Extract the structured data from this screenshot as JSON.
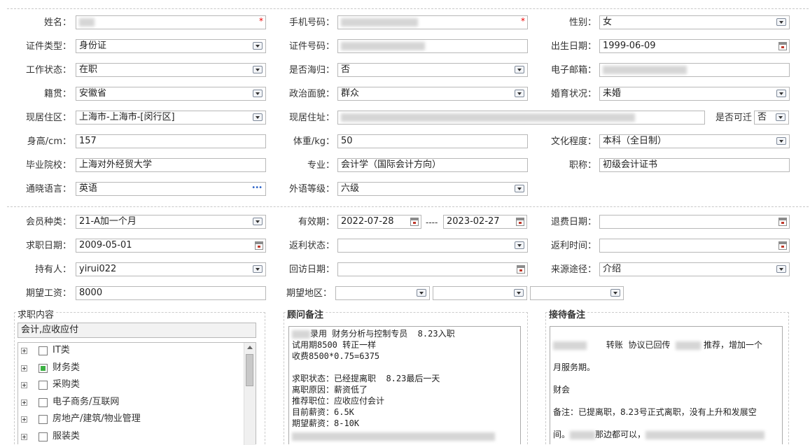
{
  "personal": {
    "name_label": "姓名：",
    "phone_label": "手机号码：",
    "gender_label": "性别：",
    "gender_value": "女",
    "id_type_label": "证件类型：",
    "id_type_value": "身份证",
    "id_number_label": "证件号码：",
    "birth_label": "出生日期：",
    "birth_value": "1999-06-09",
    "work_status_label": "工作状态：",
    "work_status_value": "在职",
    "returnee_label": "是否海归：",
    "returnee_value": "否",
    "email_label": "电子邮箱：",
    "native_label": "籍贯：",
    "native_value": "安徽省",
    "political_label": "政治面貌：",
    "political_value": "群众",
    "marital_label": "婚育状况：",
    "marital_value": "未婚",
    "residence_area_label": "现居住区：",
    "residence_area_value": "上海市-上海市-[闵行区]",
    "residence_addr_label": "现居住址：",
    "relocate_label": "是否可迁",
    "relocate_value": "否",
    "height_label": "身高/cm：",
    "height_value": "157",
    "weight_label": "体重/kg：",
    "weight_value": "50",
    "education_label": "文化程度：",
    "education_value": "本科（全日制）",
    "school_label": "毕业院校：",
    "school_value": "上海对外经贸大学",
    "major_label": "专业：",
    "major_value": "会计学（国际会计方向）",
    "title_label": "职称：",
    "title_value": "初级会计证书",
    "language_label": "通晓语言：",
    "language_value": "英语",
    "lang_level_label": "外语等级：",
    "lang_level_value": "六级",
    "more_glyph": "•••"
  },
  "membership": {
    "type_label": "会员种类：",
    "type_value": "21-A加一个月",
    "valid_label": "有效期：",
    "valid_from": "2022-07-28",
    "valid_sep": "----",
    "valid_to": "2023-02-27",
    "refund_date_label": "退费日期：",
    "job_date_label": "求职日期：",
    "job_date_value": "2009-05-01",
    "rebate_status_label": "返利状态：",
    "rebate_time_label": "返利时间：",
    "holder_label": "持有人：",
    "holder_value": "yirui022",
    "visit_date_label": "回访日期：",
    "source_label": "来源途径：",
    "source_value": "介绍",
    "salary_label": "期望工资：",
    "salary_value": "8000",
    "region_label": "期望地区："
  },
  "job_content": {
    "title": "求职内容",
    "summary": "会计,应收应付",
    "tree": [
      {
        "label": "IT类",
        "checked": false
      },
      {
        "label": "财务类",
        "checked": true
      },
      {
        "label": "采购类",
        "checked": false
      },
      {
        "label": "电子商务/互联网",
        "checked": false
      },
      {
        "label": "房地产/建筑/物业管理",
        "checked": false
      },
      {
        "label": "服装类",
        "checked": false
      }
    ]
  },
  "advisor_notes": {
    "title": "顾问备注",
    "lines": [
      "录用 财务分析与控制专员  8.23入职",
      "试用期8500 转正一样",
      "收费8500*0.75=6375",
      "",
      "求职状态：已经提离职  8.23最后一天",
      "离职原因：薪资低了",
      "推荐职位：应收应付会计",
      "目前薪资：6.5K",
      "期望薪资：8-10K"
    ]
  },
  "reception_notes": {
    "title": "接待备注",
    "line1_a": "转账  协议已回传",
    "line1_b": "推荐，增加一个",
    "line2": "月服务期。",
    "line3": "财会",
    "line4": "备注：已提离职，8.23号正式离职，没有上升和发展空",
    "line5_a": "间。",
    "line5_b": "那边都可以，"
  },
  "colors": {
    "required": "#ee0000",
    "checked": "#3cb043"
  }
}
